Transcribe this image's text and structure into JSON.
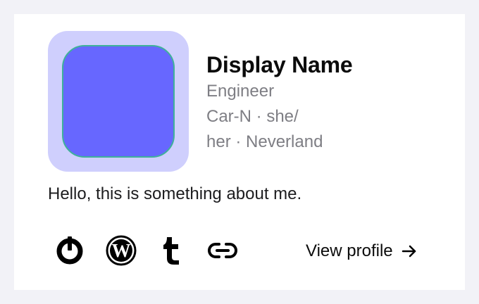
{
  "profile": {
    "display_name": "Display Name",
    "job": "Engineer",
    "meta_line_1": "Car-N · she/",
    "meta_line_2": "her · Neverland",
    "bio": "Hello, this is something about me."
  },
  "avatar": {
    "frame_color": "#cfcffd",
    "fill_color": "#6767ff",
    "border_color": "#3fb19a"
  },
  "social_links": [
    {
      "icon": "power-icon"
    },
    {
      "icon": "wordpress-icon"
    },
    {
      "icon": "tumblr-icon"
    },
    {
      "icon": "link-icon"
    }
  ],
  "actions": {
    "view_profile_label": "View profile",
    "view_profile_icon": "arrow-right-icon"
  }
}
